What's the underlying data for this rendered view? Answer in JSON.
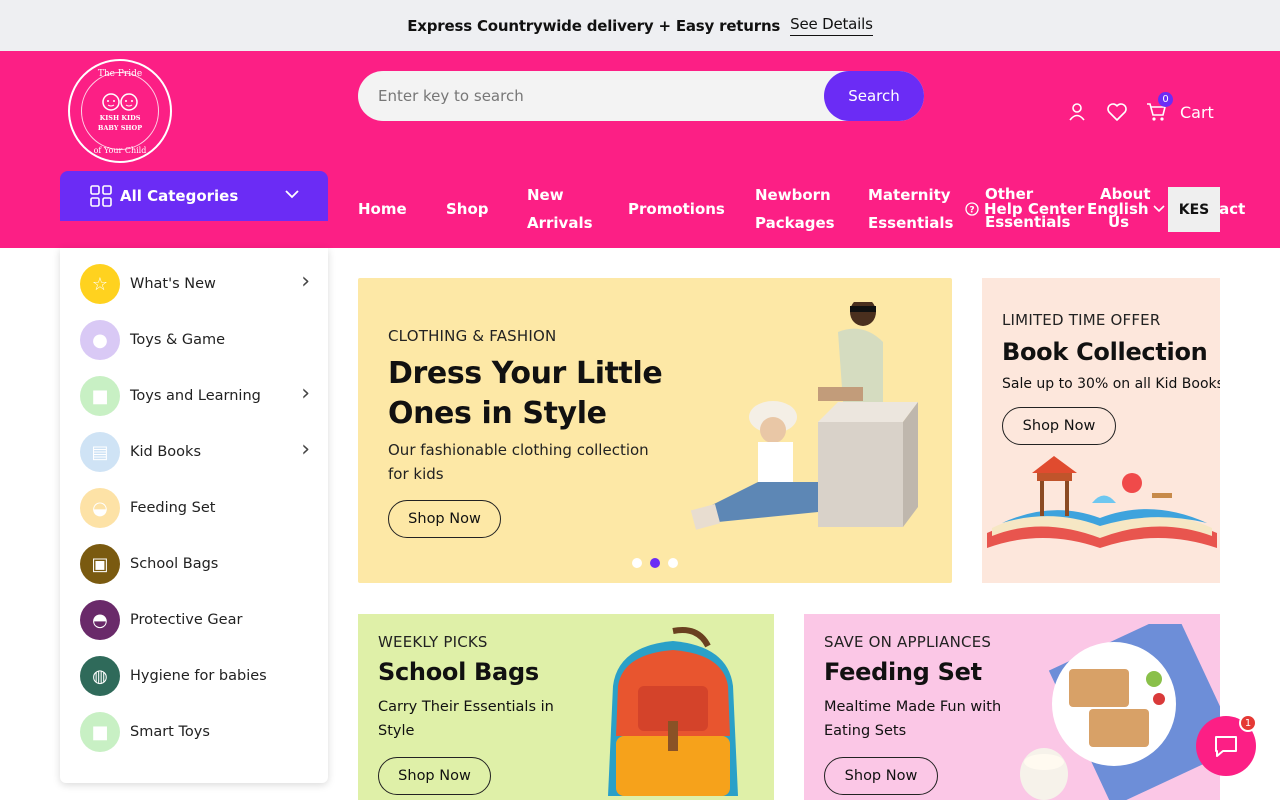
{
  "announcement": {
    "text": "Express Countrywide delivery + Easy returns",
    "link": "See Details"
  },
  "logo": {
    "arc_top": "The Pride",
    "brand_line1": "KISH KIDS",
    "brand_line2": "BABY SHOP",
    "arc_bottom": "of Your Child"
  },
  "search": {
    "placeholder": "Enter key to search",
    "button": "Search"
  },
  "header_icons": {
    "cart_label": "Cart",
    "cart_count": "0"
  },
  "all_categories": {
    "label": "All Categories"
  },
  "nav": {
    "home": "Home",
    "shop": "Shop",
    "new_arrivals_1": "New",
    "new_arrivals_2": "Arrivals",
    "promotions": "Promotions",
    "newborn_1": "Newborn",
    "newborn_2": "Packages",
    "maternity_1": "Maternity",
    "maternity_2": "Essentials",
    "other_1": "Other",
    "other_2": "Essentials",
    "help_center": "Help Center",
    "about_1": "About",
    "about_2": "Us",
    "language": "English",
    "contact_tail": "tact",
    "currency": "KES"
  },
  "categories": [
    {
      "label": "What's New",
      "icon": "star-icon",
      "bg": "#ffd21f",
      "arrow": true
    },
    {
      "label": "Toys & Game",
      "icon": "toy-icon",
      "bg": "#d9c9f5",
      "arrow": false
    },
    {
      "label": "Toys and Learning",
      "icon": "blocks-icon",
      "bg": "#c8f0c4",
      "arrow": true
    },
    {
      "label": "Kid Books",
      "icon": "book-icon",
      "bg": "#cfe3f5",
      "arrow": true
    },
    {
      "label": "Feeding Set",
      "icon": "bowl-icon",
      "bg": "#fde2a6",
      "arrow": false
    },
    {
      "label": "School Bags",
      "icon": "backpack-icon",
      "bg": "#7a5a10",
      "arrow": false
    },
    {
      "label": "Protective Gear",
      "icon": "helmet-icon",
      "bg": "#6a2a6a",
      "arrow": false
    },
    {
      "label": "Hygiene for babies",
      "icon": "bath-icon",
      "bg": "#2f6a5a",
      "arrow": false
    },
    {
      "label": "Smart Toys",
      "icon": "blocks-icon",
      "bg": "#c8f0c4",
      "arrow": false
    }
  ],
  "hero": {
    "eyebrow": "CLOTHING & FASHION",
    "title_1": "Dress Your Little",
    "title_2": "Ones in Style",
    "desc_1": "Our fashionable clothing collection",
    "desc_2": "for kids",
    "button": "Shop Now",
    "active_slide": 2,
    "slide_count": 3
  },
  "books": {
    "eyebrow": "LIMITED TIME OFFER",
    "title": "Book Collection",
    "desc": "Sale up to 30% on all Kid Books",
    "button": "Shop Now"
  },
  "bags": {
    "eyebrow": "WEEKLY PICKS",
    "title": "School Bags",
    "desc_1": "Carry Their Essentials in",
    "desc_2": "Style",
    "button": "Shop Now"
  },
  "feeding": {
    "eyebrow": "SAVE ON APPLIANCES",
    "title": "Feeding Set",
    "desc_1": "Mealtime Made Fun with",
    "desc_2": "Eating Sets",
    "button": "Shop Now"
  },
  "chat": {
    "badge": "1"
  },
  "colors": {
    "brand_pink": "#fc1f85",
    "accent_purple": "#6b2cf5",
    "hero_bg": "#fde8a6",
    "books_bg": "#fde7dc",
    "bags_bg": "#dff0a8",
    "feeding_bg": "#fbc7e6"
  }
}
